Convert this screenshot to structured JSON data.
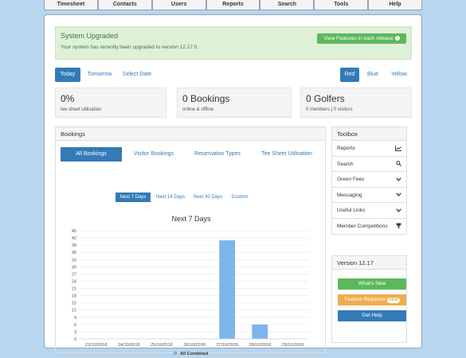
{
  "nav": [
    "Timesheet",
    "Contacts",
    "Users",
    "Reports",
    "Search",
    "Tools",
    "Help"
  ],
  "alert": {
    "title": "System Upgraded",
    "message": "Your system has recently been upgraded to version 12.17.0.",
    "button": "View Features in each release",
    "button_icon": "info-icon"
  },
  "day_tabs": [
    "Today",
    "Tomorrow",
    "Select Date"
  ],
  "color_tabs": [
    "Red",
    "Blue",
    "Yellow"
  ],
  "stats": [
    {
      "value": "0%",
      "label": "tee sheet utilisation"
    },
    {
      "value": "0 Bookings",
      "label": "online & offline"
    },
    {
      "value": "0 Golfers",
      "label": "0 members | 0 visitors"
    }
  ],
  "bookings": {
    "title": "Bookings",
    "tabs": [
      "All Bookings",
      "Visitor Bookings",
      "Reservation Types",
      "Tee Sheet Utilisation"
    ],
    "periods": [
      "Next 7 Days",
      "Next 14 Days",
      "Next 30 Days",
      "Custom"
    ]
  },
  "toolbox": {
    "title": "Toolbox",
    "items": [
      {
        "label": "Reports",
        "icon": "chart-icon"
      },
      {
        "label": "Search",
        "icon": "search-icon"
      },
      {
        "label": "Green Fees",
        "icon": "chevron-down-icon"
      },
      {
        "label": "Messaging",
        "icon": "chevron-down-icon"
      },
      {
        "label": "Useful Links",
        "icon": "chevron-down-icon"
      },
      {
        "label": "Member Competitions",
        "icon": "trophy-icon"
      }
    ]
  },
  "version": {
    "title": "Version 12.17",
    "whats_new": "What's New",
    "feature_requests": "Feature Requests",
    "new_badge": "NEW",
    "get_help": "Get Help"
  },
  "chart_data": {
    "type": "bar",
    "title": "Next 7 Days",
    "categories": [
      "23/10/2018",
      "24/10/2018",
      "25/10/2018",
      "26/10/2018",
      "27/10/2018",
      "28/10/2018",
      "29/10/2018"
    ],
    "series": [
      {
        "name": "All Combined",
        "values": [
          0,
          0,
          0,
          0,
          41,
          6,
          0
        ],
        "color": "#7cb5ec"
      }
    ],
    "ylim": [
      0,
      45
    ],
    "yticks": [
      0,
      3,
      6,
      9,
      12,
      15,
      18,
      21,
      24,
      27,
      30,
      33,
      36,
      39,
      42,
      45
    ],
    "grid": true,
    "legend": "bottom"
  },
  "colors": {
    "primary": "#337ab7",
    "success": "#5cb85c",
    "warning": "#f0ad4e",
    "alert_bg": "#dff0d8"
  }
}
